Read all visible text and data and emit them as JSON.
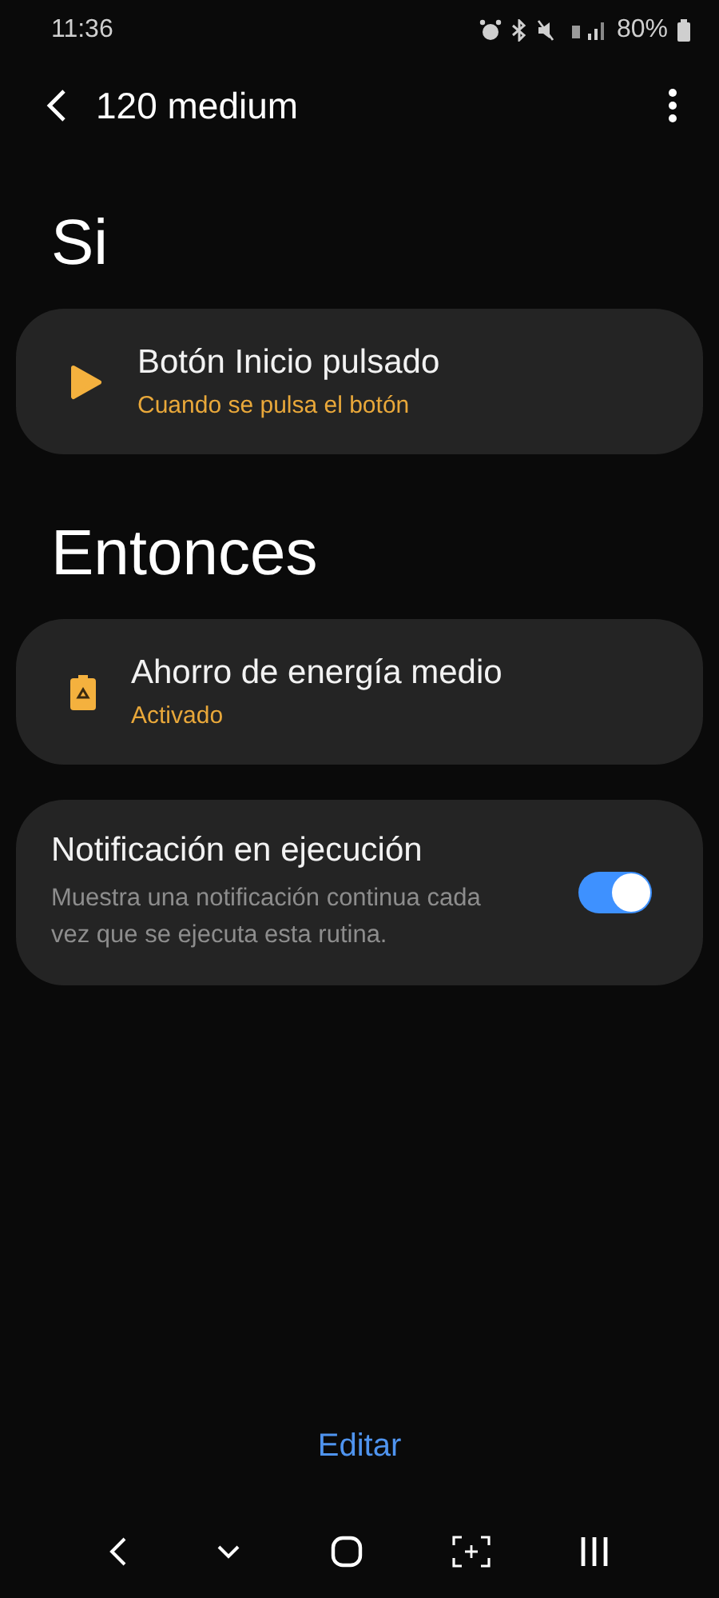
{
  "status_bar": {
    "time": "11:36",
    "battery": "80%"
  },
  "header": {
    "title": "120 medium"
  },
  "if_section": {
    "title": "Si",
    "items": [
      {
        "kind": "play",
        "title": "Botón Inicio pulsado",
        "subtitle": "Cuando se pulsa el botón"
      }
    ]
  },
  "then_section": {
    "title": "Entonces",
    "items": [
      {
        "kind": "battery",
        "title": "Ahorro de energía medio",
        "subtitle": "Activado"
      }
    ]
  },
  "running_notification": {
    "title": "Notificación en ejecución",
    "description": "Muestra una notificación continua cada vez que se ejecuta esta rutina.",
    "on": true
  },
  "edit_button": "Editar"
}
